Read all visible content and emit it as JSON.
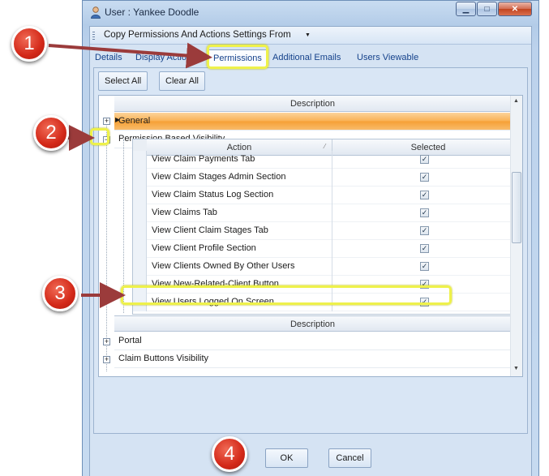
{
  "window": {
    "title": "User : Yankee Doodle",
    "controls": [
      "minimize",
      "maximize",
      "close"
    ]
  },
  "menu": {
    "label": "Copy Permissions And Actions Settings From"
  },
  "tabs": [
    {
      "label": "Details",
      "active": false
    },
    {
      "label": "Display Actions",
      "active": false
    },
    {
      "label": "Permissions",
      "active": true
    },
    {
      "label": "Additional Emails",
      "active": false
    },
    {
      "label": "Users Viewable",
      "active": false
    }
  ],
  "toolbar": {
    "select_all": "Select All",
    "clear_all": "Clear All"
  },
  "grid": {
    "header": "Description",
    "groups_top": [
      {
        "label": "General",
        "expanded": false,
        "selected": true
      },
      {
        "label": "Permission Based Visibility",
        "expanded": true
      }
    ],
    "subgrid": {
      "columns": [
        "Action",
        "Selected"
      ],
      "rows": [
        {
          "action": "View Claim Payments Tab",
          "selected": true
        },
        {
          "action": "View Claim Stages Admin Section",
          "selected": true
        },
        {
          "action": "View Claim Status Log Section",
          "selected": true
        },
        {
          "action": "View Claims Tab",
          "selected": true
        },
        {
          "action": "View Client Claim Stages Tab",
          "selected": true
        },
        {
          "action": "View Client Profile Section",
          "selected": true
        },
        {
          "action": "View Clients Owned By Other Users",
          "selected": true
        },
        {
          "action": "View New-Related-Client Button",
          "selected": true
        },
        {
          "action": "View Users Logged On Screen",
          "selected": true
        }
      ]
    },
    "header2": "Description",
    "groups_bottom": [
      {
        "label": "Portal",
        "expanded": false
      },
      {
        "label": "Claim Buttons Visibility",
        "expanded": false
      }
    ]
  },
  "buttons": {
    "ok": "OK",
    "cancel": "Cancel"
  },
  "annotations": {
    "callouts": [
      "1",
      "2",
      "3",
      "4"
    ],
    "callout_color": "#d32818",
    "highlight_color": "#eef14a",
    "arrow_color": "#9b3b3b"
  },
  "colors": {
    "accent": "#15428b",
    "selected_row": "#f9b052"
  }
}
